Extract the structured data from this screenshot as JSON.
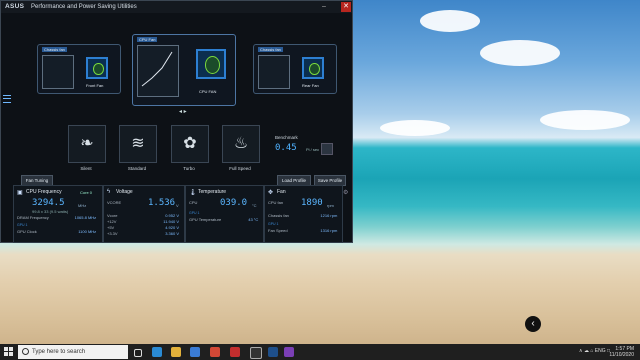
{
  "app": {
    "logo": "ASUS",
    "title": "Performance and Power Saving Utilities",
    "min": "–",
    "max": "□",
    "close": "✕"
  },
  "cards": {
    "left_label": "Chassis fan",
    "center_label": "CPU Fan",
    "right_label": "Chassis fan",
    "center_fan_caption": "CPU FAN",
    "left_fan_caption": "Front Fan",
    "right_fan_caption": "Rear Fan"
  },
  "modes": [
    {
      "label": "Silent"
    },
    {
      "label": "Standard"
    },
    {
      "label": "Turbo"
    },
    {
      "label": "Full Speed"
    }
  ],
  "benchmark": {
    "label": "Benchmark",
    "value": "0.45",
    "unit": "Pi / sec"
  },
  "buttons": {
    "fan_tuning": "Fan Tuning",
    "load_profile": "Load Profile",
    "save_profile": "Save Profile"
  },
  "panels": {
    "cpu": {
      "title": "CPU Frequency",
      "core": "Core 0",
      "value": "3294.5",
      "unit": "MHz",
      "sub": "99.8 x 33 (9.5 watts)",
      "row1_label": "DRAM Frequency",
      "row1_value": "1065.8 MHz",
      "link": "GPU 1",
      "row2_label": "GPU Clock",
      "row2_value": "1100 MHz"
    },
    "voltage": {
      "title": "Voltage",
      "row0_label": "VCORE",
      "value": "1.536",
      "unit": "V",
      "rows": [
        {
          "label": "Vcore",
          "value": "0.952 V"
        },
        {
          "label": "+12V",
          "value": "11.940 V"
        },
        {
          "label": "+5V",
          "value": "4.920 V"
        },
        {
          "label": "+3.3V",
          "value": "3.360 V"
        }
      ]
    },
    "temperature": {
      "title": "Temperature",
      "row0_label": "CPU",
      "value": "039.0",
      "unit": "°C",
      "link": "GPU 1",
      "row1_label": "GPU Temperature",
      "row1_value": "43 °C"
    },
    "fan": {
      "title": "Fan",
      "row0_label": "CPU fan",
      "value": "1890",
      "unit": "rpm",
      "row1_label": "Chassis fan",
      "row1_value": "1216 rpm",
      "link": "GPU 1",
      "row2_label": "Fan Speed",
      "row2_value": "1316 rpm"
    }
  },
  "taskbar": {
    "search_placeholder": "Type here to search",
    "time": "1:57 PM",
    "date": "11/10/2020",
    "tray": "∧  ☁  ⌂  ENG  □"
  }
}
